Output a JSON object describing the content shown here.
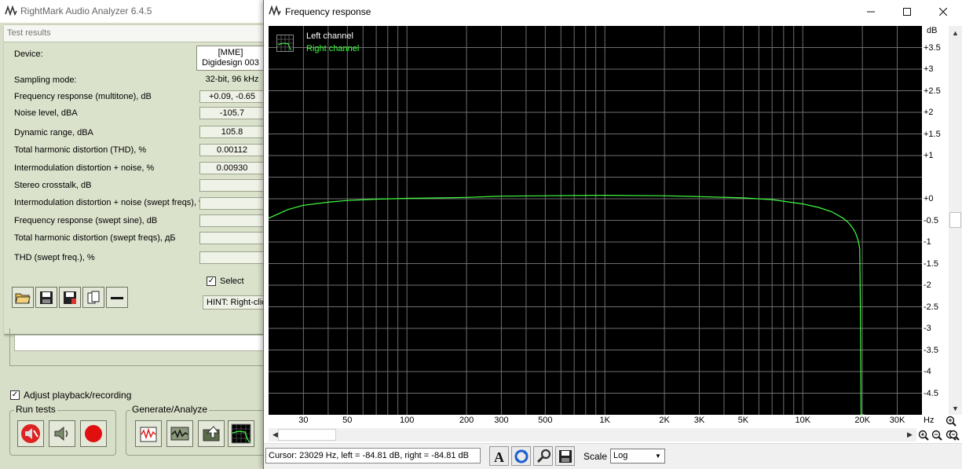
{
  "main_window": {
    "title": "RightMark Audio Analyzer 6.4.5",
    "results_title": "Test results",
    "device_label": "Device:",
    "device_value_line1": "[MME]",
    "device_value_line2": "Digidesign 003",
    "rows": [
      {
        "label": "Sampling mode:",
        "value": "32-bit, 96 kHz"
      },
      {
        "label": "Frequency response (multitone), dB",
        "value": "+0.09, -0.65"
      },
      {
        "label": "Noise level, dBA",
        "value": "-105.7"
      },
      {
        "label": "Dynamic range, dBA",
        "value": "105.8"
      },
      {
        "label": "Total harmonic distortion (THD), %",
        "value": "0.00112"
      },
      {
        "label": "Intermodulation distortion + noise, %",
        "value": "0.00930"
      },
      {
        "label": "Stereo crosstalk, dB",
        "value": ""
      },
      {
        "label": "Intermodulation distortion + noise (swept freqs), %",
        "value": ""
      },
      {
        "label": "Frequency response (swept sine), dB",
        "value": ""
      },
      {
        "label": "Total harmonic distortion (swept freqs), дБ",
        "value": ""
      },
      {
        "label": "THD (swept freq.), %",
        "value": ""
      }
    ],
    "select_label": "Select",
    "select_checked": true,
    "hint_text": "HINT: Right-clic",
    "toolbar_icons": [
      "open-folder-icon",
      "save-icon",
      "save-all-icon",
      "copy-icon",
      "dash-icon"
    ],
    "adjust_label": "Adjust playback/recording",
    "adjust_checked": true,
    "run_tests_label": "Run tests",
    "generate_label": "Generate/Analyze"
  },
  "freq_window": {
    "title": "Frequency response",
    "legend": {
      "left": "Left channel",
      "right": "Right channel"
    },
    "cursor_text": "Cursor:  23029 Hz,  left = -84.81 dB,  right = -84.81 dB",
    "scale_label": "Scale",
    "scale_value": "Log",
    "colors": {
      "plot_bg": "#000000",
      "grid": "#6e6e6e",
      "right_channel": "#40ff40",
      "left_channel": "#ffffff"
    }
  },
  "chart_data": {
    "type": "line",
    "title": "",
    "xlabel": "Hz",
    "ylabel": "dB",
    "x_scale": "log",
    "xlim": [
      20,
      40000
    ],
    "ylim": [
      -5,
      4
    ],
    "x_tick_labels": [
      "30",
      "50",
      "100",
      "200",
      "300",
      "500",
      "1K",
      "2K",
      "3K",
      "5K",
      "10K",
      "20K",
      "30K"
    ],
    "y_tick_labels": [
      "+3.5",
      "+3",
      "+2.5",
      "+2",
      "+1.5",
      "+1",
      "+0",
      "-0.5",
      "-1",
      "-1.5",
      "-2",
      "-2.5",
      "-3",
      "-3.5",
      "-4",
      "-4.5"
    ],
    "grid": true,
    "legend": "top-left",
    "series": [
      {
        "name": "Right channel",
        "x": [
          20,
          25,
          30,
          40,
          50,
          70,
          100,
          150,
          200,
          300,
          500,
          1000,
          2000,
          3000,
          5000,
          7000,
          10000,
          12000,
          14000,
          16000,
          17000,
          18000,
          18500,
          19000,
          19200,
          19400,
          19550,
          19700,
          20000,
          20500
        ],
        "y": [
          -0.45,
          -0.25,
          -0.15,
          -0.08,
          -0.04,
          -0.01,
          0.01,
          0.02,
          0.03,
          0.06,
          0.07,
          0.08,
          0.07,
          0.05,
          0.02,
          -0.02,
          -0.12,
          -0.2,
          -0.3,
          -0.45,
          -0.55,
          -0.7,
          -0.8,
          -0.95,
          -1.05,
          -1.15,
          -2.5,
          -5,
          -5,
          -5
        ]
      }
    ]
  }
}
